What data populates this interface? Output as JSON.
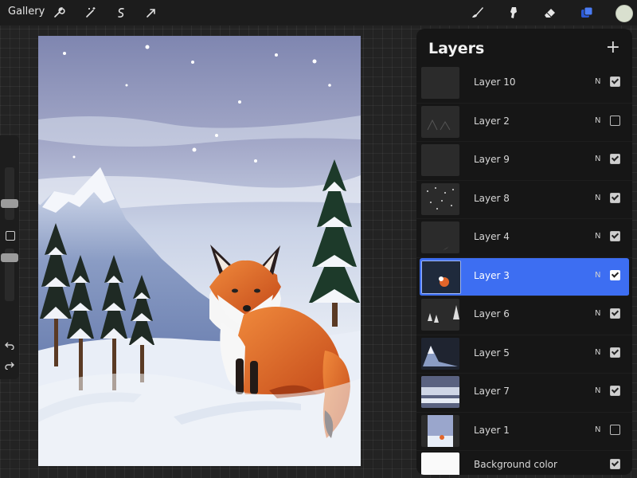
{
  "topbar": {
    "gallery_label": "Gallery",
    "left_tools": [
      "wrench-icon",
      "magic-wand-icon",
      "selection-icon",
      "transform-arrow-icon"
    ],
    "right_tools": [
      "brush-icon",
      "smudge-icon",
      "eraser-icon",
      "layers-icon"
    ],
    "active_color": "#d9e0cf",
    "accent": "#3d6ef2"
  },
  "sidebar": {
    "controls": [
      "brush-size-slider",
      "modify-button",
      "opacity-slider",
      "undo-icon",
      "redo-icon"
    ]
  },
  "canvas": {
    "subject": "winter-fox-painting",
    "sky_color": "#8f95b8",
    "snow_color": "#e8eef8",
    "fox_color": "#e2652a"
  },
  "layers_panel": {
    "title": "Layers",
    "add_icon": "+",
    "layers": [
      {
        "name": "Layer 10",
        "blend": "N",
        "visible": true,
        "selected": false
      },
      {
        "name": "Layer 2",
        "blend": "N",
        "visible": false,
        "selected": false
      },
      {
        "name": "Layer 9",
        "blend": "N",
        "visible": true,
        "selected": false
      },
      {
        "name": "Layer 8",
        "blend": "N",
        "visible": true,
        "selected": false
      },
      {
        "name": "Layer 4",
        "blend": "N",
        "visible": true,
        "selected": false
      },
      {
        "name": "Layer 3",
        "blend": "N",
        "visible": true,
        "selected": true
      },
      {
        "name": "Layer 6",
        "blend": "N",
        "visible": true,
        "selected": false
      },
      {
        "name": "Layer 5",
        "blend": "N",
        "visible": true,
        "selected": false
      },
      {
        "name": "Layer 7",
        "blend": "N",
        "visible": true,
        "selected": false
      },
      {
        "name": "Layer 1",
        "blend": "N",
        "visible": false,
        "selected": false
      }
    ],
    "background": {
      "name": "Background color",
      "visible": true
    }
  }
}
